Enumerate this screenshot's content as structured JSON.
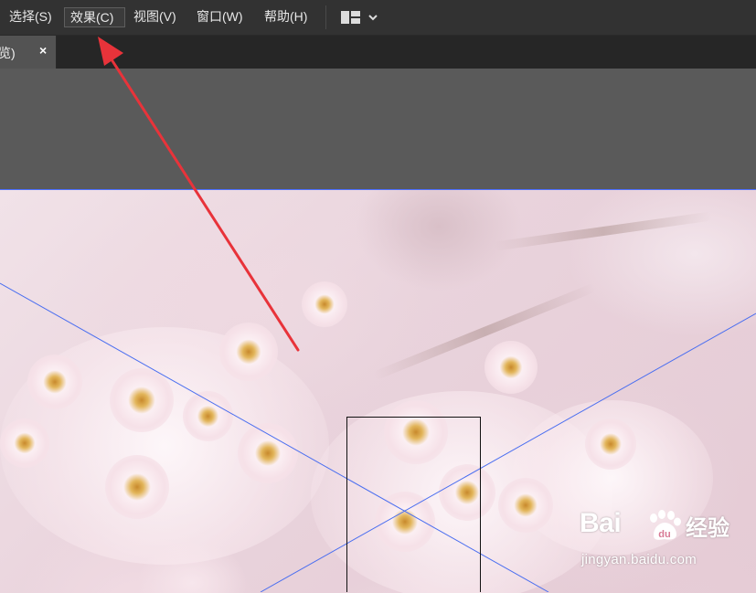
{
  "menubar": {
    "items": [
      {
        "label": "选择(S)",
        "active": false
      },
      {
        "label": "效果(C)",
        "active": true
      },
      {
        "label": "视图(V)",
        "active": false
      },
      {
        "label": "窗口(W)",
        "active": false
      },
      {
        "label": "帮助(H)",
        "active": false
      }
    ],
    "workspace_switcher_icon": "layout-grid-icon",
    "workspace_switcher_arrow": "chevron-down-icon"
  },
  "document_tab": {
    "title": "览)",
    "close_glyph": "×"
  },
  "annotation": {
    "arrow_color": "#e8333a",
    "points_to": "效果(C)"
  },
  "guides": {
    "color": "#4a6ef0",
    "selection_box_color": "#000000"
  },
  "watermark": {
    "logo": "Bai",
    "logo_suffix": "经验",
    "logo_icon": "paw-du-icon",
    "url": "jingyan.baidu.com"
  }
}
